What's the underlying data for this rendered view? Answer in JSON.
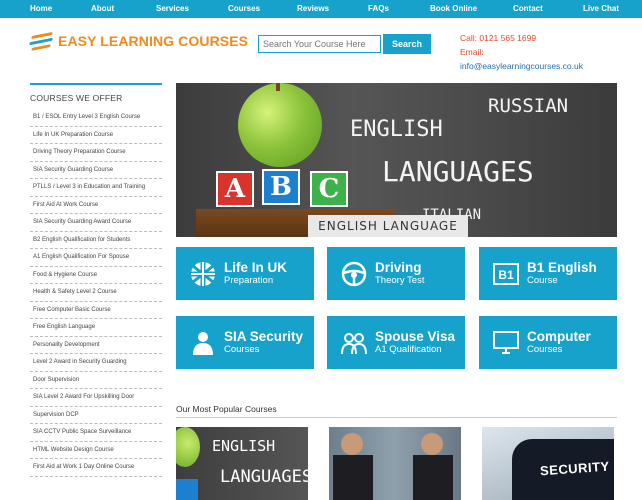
{
  "nav": [
    "Home",
    "About",
    "Services",
    "Courses",
    "Reviews",
    "FAQs",
    "Book Online",
    "Contact",
    "Live Chat"
  ],
  "logo": {
    "text": "EASY LEARNING COURSES"
  },
  "search": {
    "placeholder": "Search Your Course Here",
    "button": "Search"
  },
  "contact": {
    "phone": "Call: 0121 565 1699",
    "email_label": "Email:",
    "email": "info@easylearningcourses.co.uk"
  },
  "sidebar": {
    "title": "COURSES WE OFFER",
    "items": [
      "B1 / ESOL Entry Level 3 English Course",
      "Life In UK Preparation Course",
      "Driving Theory Preparation Course",
      "SIA Security Guarding Course",
      "PTLLS / Level 3 in Education and Training",
      "First Aid At Work Course",
      "SIA Security Guarding Award Course",
      "B2 English Qualification for Students",
      "A1 English Qualification For Spouse",
      "Food & Hygiene Course",
      "Health & Safety Level 2 Course",
      "Free Computer Basic Course",
      "Free English Language",
      "Personality Development",
      "Level 2 Award in Security Guarding",
      "Door Supervision",
      "SIA Level 2 Award For Upskilling Door",
      "Supervision DCP",
      "SIA CCTV Public Space Surveillance",
      "HTML Website Design Course",
      "First Aid at Work 1 Day Online Course"
    ]
  },
  "banner": {
    "english": "ENGLISH",
    "languages": "LANGUAGES",
    "russian": "RUSSIAN",
    "italian": "ITALIAN",
    "abc": [
      "A",
      "B",
      "C"
    ],
    "caption": "ENGLISH LANGUAGE"
  },
  "tiles": [
    {
      "title": "Life In UK",
      "subtitle": "Preparation",
      "icon": "uk-flag-icon"
    },
    {
      "title": "Driving",
      "subtitle": "Theory Test",
      "icon": "steering-wheel-icon"
    },
    {
      "title": "B1 English",
      "subtitle": "Course",
      "icon": "b1-badge-icon"
    },
    {
      "title": "SIA Security",
      "subtitle": "Courses",
      "icon": "person-icon"
    },
    {
      "title": "Spouse Visa",
      "subtitle": "A1 Qualification",
      "icon": "couple-icon"
    },
    {
      "title": "Computer",
      "subtitle": "Courses",
      "icon": "monitor-icon"
    }
  ],
  "popular": {
    "title": "Our Most Popular Courses",
    "card1": {
      "line1": "ENGLISH",
      "line2": "LANGUAGES"
    },
    "card3": {
      "text": "SECURITY"
    }
  },
  "colors": {
    "primary": "#17a2cc",
    "logo": "#f08a1c",
    "phone": "#e14b2b",
    "email": "#1a6fb0"
  }
}
